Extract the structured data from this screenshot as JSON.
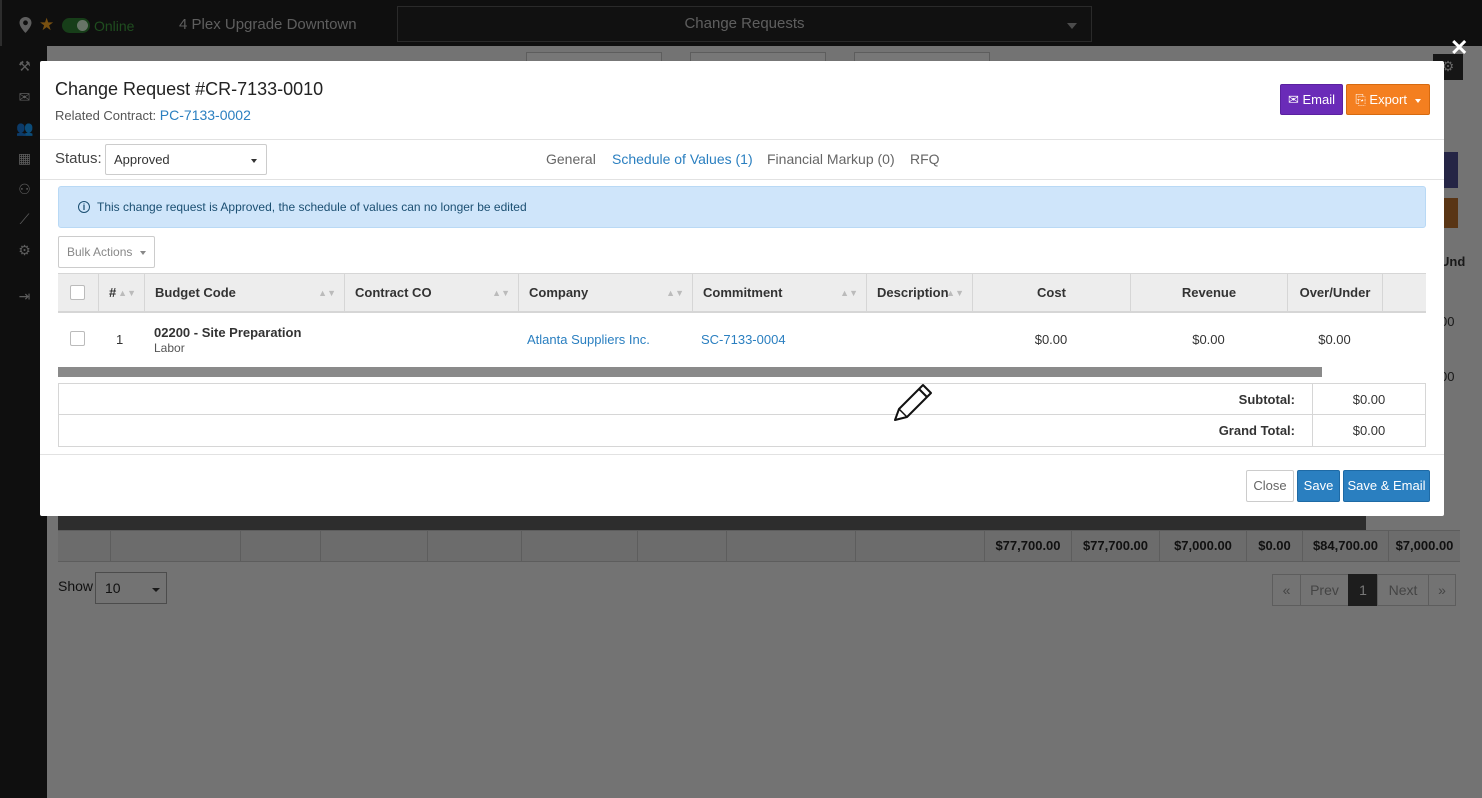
{
  "topbar": {
    "status": "Online",
    "project": "4 Plex Upgrade Downtown",
    "module": "Change Requests",
    "icons": [
      "map-pin-icon",
      "star-icon",
      "online-toggle"
    ]
  },
  "sidebar": {
    "icons": [
      "hammer-icon",
      "mail-icon",
      "users-icon",
      "calendar-icon",
      "user-settings-icon",
      "chart-icon",
      "gear-icon",
      "logout-icon"
    ]
  },
  "background": {
    "column_fragment": "Und",
    "row_values": [
      "00",
      "00"
    ],
    "totals": [
      "$77,700.00",
      "$77,700.00",
      "$7,000.00",
      "$0.00",
      "$84,700.00",
      "$7,000.00"
    ],
    "show_label": "Show",
    "show_value": "10",
    "pager": {
      "first": "«",
      "prev": "Prev",
      "page": "1",
      "next": "Next",
      "last": "»"
    }
  },
  "modal": {
    "title": "Change Request #CR-7133-0010",
    "related_label": "Related Contract:",
    "related_link": "PC-7133-0002",
    "email_button": "Email",
    "export_button": "Export",
    "status_label": "Status:",
    "status_value": "Approved",
    "tabs": [
      {
        "label": "General",
        "active": false
      },
      {
        "label": "Schedule of Values (1)",
        "active": true
      },
      {
        "label": "Financial Markup (0)",
        "active": false
      },
      {
        "label": "RFQ",
        "active": false
      }
    ],
    "alert": "This change request is Approved, the schedule of values can no longer be edited",
    "bulk_actions": "Bulk Actions",
    "columns": [
      "#",
      "Budget Code",
      "Contract CO",
      "Company",
      "Commitment",
      "Description",
      "Cost",
      "Revenue",
      "Over/Under"
    ],
    "rows": [
      {
        "num": "1",
        "budget_code": "02200 - Site Preparation",
        "budget_sub": "Labor",
        "contract_co": "",
        "company": "Atlanta Suppliers Inc.",
        "commitment": "SC-7133-0004",
        "description": "",
        "cost": "$0.00",
        "revenue": "$0.00",
        "over_under": "$0.00"
      }
    ],
    "subtotal_label": "Subtotal:",
    "subtotal_value": "$0.00",
    "grand_total_label": "Grand Total:",
    "grand_total_value": "$0.00",
    "close_button": "Close",
    "save_button": "Save",
    "save_email_button": "Save & Email"
  },
  "colors": {
    "accent_blue": "#2a7fc0",
    "email_purple": "#6a2bb8",
    "export_orange": "#f47f20",
    "alert_bg": "#cfe5fa",
    "online_green": "#3e9b3e"
  }
}
